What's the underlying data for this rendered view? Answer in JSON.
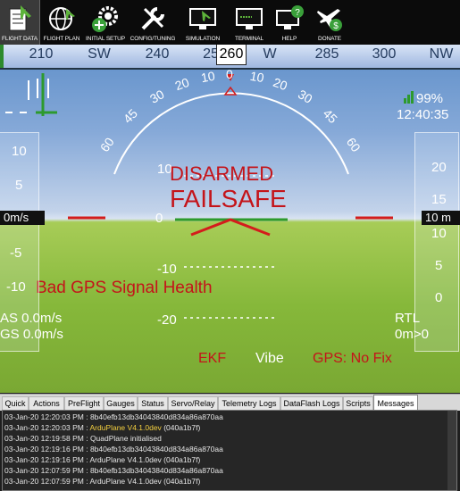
{
  "toolbar": {
    "buttons": [
      {
        "label": "FLIGHT DATA",
        "icon": "flight-data-icon"
      },
      {
        "label": "FLIGHT PLAN",
        "icon": "globe-icon"
      },
      {
        "label": "INITIAL SETUP",
        "icon": "setup-gears-icon"
      },
      {
        "label": "CONFIG/TUNING",
        "icon": "wrench-icon"
      },
      {
        "label": "SIMULATION",
        "icon": "monitor-plane-icon"
      },
      {
        "label": "TERMINAL",
        "icon": "terminal-icon"
      },
      {
        "label": "HELP",
        "icon": "help-icon"
      },
      {
        "label": "DONATE",
        "icon": "donate-plane-icon"
      }
    ]
  },
  "hud": {
    "heading": {
      "current": "260",
      "ticks": [
        "210",
        "SW",
        "240",
        "25",
        "W",
        "285",
        "300",
        "NW"
      ]
    },
    "pitch_labels": [
      "10",
      "0",
      "-10",
      "-20"
    ],
    "roll_labels": [
      "60",
      "45",
      "30",
      "20",
      "10",
      "0",
      "10",
      "20",
      "30",
      "45",
      "60"
    ],
    "status": {
      "armed": "DISARMED",
      "failsafe": "FAILSAFE",
      "message": "Bad GPS Signal Health"
    },
    "battery_percent": "99%",
    "clock": "12:40:35",
    "speed_tape": {
      "labels": [
        "10",
        "5",
        "0",
        "-5",
        "-10"
      ],
      "value": "0m/s"
    },
    "alt_tape": {
      "labels": [
        "20",
        "15",
        "10",
        "5",
        "0"
      ],
      "value": "10 m"
    },
    "airspeed": "AS 0.0m/s",
    "groundspeed": "GS 0.0m/s",
    "mode": "RTL",
    "wp_dist": "0m>0",
    "ekf": "EKF",
    "vibe": "Vibe",
    "gps": "GPS: No Fix",
    "colors": {
      "sky": "#86a9d8",
      "ground": "#86b83a",
      "alert": "#c4141a"
    }
  },
  "tabs": {
    "items": [
      "Quick",
      "Actions",
      "PreFlight",
      "Gauges",
      "Status",
      "Servo/Relay",
      "Telemetry Logs",
      "DataFlash Logs",
      "Scripts",
      "Messages"
    ],
    "active": "Messages"
  },
  "messages": [
    {
      "time": "03-Jan-20 12:20:03 PM :",
      "text": "8b40efb13db34043840d834a86a870aa",
      "highlight": ""
    },
    {
      "time": "03-Jan-20 12:20:03 PM :",
      "text": "ArduPlane V4.1.0dev",
      "highlight": "yes",
      "suffix": "(040a1b7f)"
    },
    {
      "time": "03-Jan-20 12:19:58 PM :",
      "text": "QuadPlane initialised",
      "highlight": ""
    },
    {
      "time": "03-Jan-20 12:19:16 PM :",
      "text": "8b40efb13db34043840d834a86a870aa",
      "highlight": ""
    },
    {
      "time": "03-Jan-20 12:19:16 PM :",
      "text": "ArduPlane V4.1.0dev (040a1b7f)",
      "highlight": ""
    },
    {
      "time": "03-Jan-20 12:07:59 PM :",
      "text": "8b40efb13db34043840d834a86a870aa",
      "highlight": ""
    },
    {
      "time": "03-Jan-20 12:07:59 PM :",
      "text": "ArduPlane V4.1.0dev (040a1b7f)",
      "highlight": ""
    }
  ]
}
